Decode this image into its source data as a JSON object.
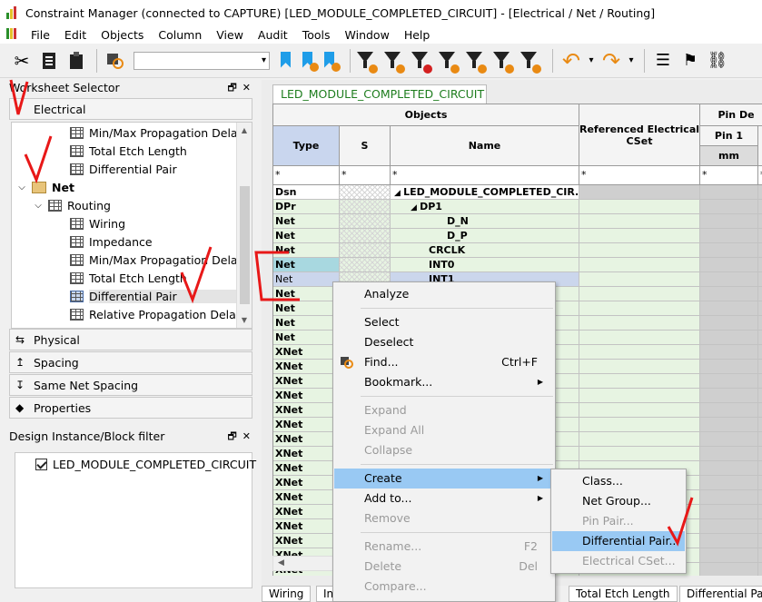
{
  "window": {
    "title": "Constraint Manager (connected to CAPTURE) [LED_MODULE_COMPLETED_CIRCUIT] - [Electrical / Net / Routing]"
  },
  "menu": [
    "File",
    "Edit",
    "Objects",
    "Column",
    "View",
    "Audit",
    "Tools",
    "Window",
    "Help"
  ],
  "toolbar": {
    "search_value": "",
    "icons": [
      "scissors-icon",
      "copy-icon",
      "paste-icon",
      "find-icon"
    ],
    "colors": {
      "filter": "#222222",
      "bookmark": "#1f9de8",
      "accent": "#e98a13"
    }
  },
  "worksheet_selector": {
    "title": "Worksheet Selector",
    "electrical_label": "Electrical",
    "tree": [
      {
        "label": "Min/Max Propagation Delays",
        "level": 3
      },
      {
        "label": "Total Etch Length",
        "level": 3
      },
      {
        "label": "Differential Pair",
        "level": 3
      },
      {
        "label": "Net",
        "level": 1
      },
      {
        "label": "Routing",
        "level": 2
      },
      {
        "label": "Wiring",
        "level": 3
      },
      {
        "label": "Impedance",
        "level": 3
      },
      {
        "label": "Min/Max Propagation Delays",
        "level": 3
      },
      {
        "label": "Total Etch Length",
        "level": 3
      },
      {
        "label": "Differential Pair",
        "level": 3,
        "selected": true
      },
      {
        "label": "Relative Propagation Delay",
        "level": 3
      }
    ],
    "sections": [
      "Physical",
      "Spacing",
      "Same Net Spacing",
      "Properties"
    ]
  },
  "design_filter": {
    "title": "Design Instance/Block filter",
    "item": "LED_MODULE_COMPLETED_CIRCUIT"
  },
  "worksheet": {
    "tab": "LED_MODULE_COMPLETED_CIRCUIT",
    "headers": {
      "objects": "Objects",
      "type": "Type",
      "s": "S",
      "name": "Name",
      "ref_cset": "Referenced Electrical CSet",
      "pin_delay": "Pin De",
      "pin1": "Pin 1",
      "mm": "mm"
    },
    "filter_value": "*",
    "rows": [
      {
        "type": "Dsn",
        "name": "LED_MODULE_COMPLETED_CIR...",
        "icon": "◢"
      },
      {
        "type": "DPr",
        "name": "DP1",
        "icon": "◢"
      },
      {
        "type": "Net",
        "name": "D_N"
      },
      {
        "type": "Net",
        "name": "D_P"
      },
      {
        "type": "Net",
        "name": "CRCLK"
      },
      {
        "type": "Net",
        "name": "INT0"
      },
      {
        "type": "Net",
        "name": "INT1"
      },
      {
        "type": "Net",
        "name": ""
      },
      {
        "type": "Net",
        "name": ""
      },
      {
        "type": "Net",
        "name": ""
      },
      {
        "type": "Net",
        "name": ""
      },
      {
        "type": "XNet",
        "name": ""
      },
      {
        "type": "XNet",
        "name": ""
      },
      {
        "type": "XNet",
        "name": ""
      },
      {
        "type": "XNet",
        "name": ""
      },
      {
        "type": "XNet",
        "name": ""
      },
      {
        "type": "XNet",
        "name": ""
      },
      {
        "type": "XNet",
        "name": ""
      },
      {
        "type": "XNet",
        "name": ""
      },
      {
        "type": "XNet",
        "name": ""
      },
      {
        "type": "XNet",
        "name": ""
      },
      {
        "type": "XNet",
        "name": ""
      },
      {
        "type": "XNet",
        "name": ""
      },
      {
        "type": "XNet",
        "name": ""
      },
      {
        "type": "XNet",
        "name": ""
      },
      {
        "type": "XNet",
        "name": ""
      },
      {
        "type": "XNet",
        "name": ""
      }
    ],
    "bottom_tabs": [
      "Wiring",
      "In",
      "Total Etch Length",
      "Differential Pair"
    ]
  },
  "context_menu": [
    {
      "label": "Analyze"
    },
    {
      "sep": true
    },
    {
      "label": "Select"
    },
    {
      "label": "Deselect"
    },
    {
      "label": "Find...",
      "shortcut": "Ctrl+F",
      "icon": "find"
    },
    {
      "label": "Bookmark...",
      "submenu": true
    },
    {
      "sep": true
    },
    {
      "label": "Expand",
      "disabled": true
    },
    {
      "label": "Expand All",
      "disabled": true
    },
    {
      "label": "Collapse",
      "disabled": true
    },
    {
      "sep": true
    },
    {
      "label": "Create",
      "submenu": true,
      "highlighted": true
    },
    {
      "label": "Add to...",
      "submenu": true
    },
    {
      "label": "Remove",
      "disabled": true
    },
    {
      "sep": true
    },
    {
      "label": "Rename...",
      "shortcut": "F2",
      "disabled": true
    },
    {
      "label": "Delete",
      "shortcut": "Del",
      "disabled": true
    },
    {
      "label": "Compare...",
      "disabled": true
    }
  ],
  "create_submenu": [
    {
      "label": "Class..."
    },
    {
      "label": "Net Group..."
    },
    {
      "label": "Pin Pair...",
      "disabled": true
    },
    {
      "label": "Differential Pair...",
      "highlighted": true
    },
    {
      "label": "Electrical CSet...",
      "disabled": true
    }
  ]
}
